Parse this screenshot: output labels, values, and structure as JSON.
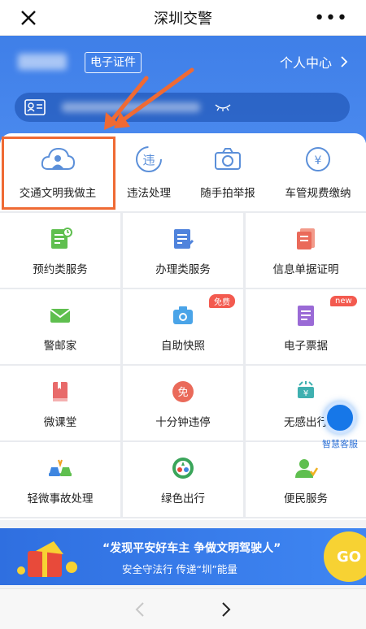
{
  "header": {
    "title": "深圳交警"
  },
  "hero": {
    "cert_tag": "电子证件",
    "personal_center": "个人中心"
  },
  "quick_actions": [
    {
      "label": "交通文明我做主"
    },
    {
      "label": "违法处理"
    },
    {
      "label": "随手拍举报"
    },
    {
      "label": "车管规费缴纳"
    }
  ],
  "grid": [
    {
      "label": "预约类服务"
    },
    {
      "label": "办理类服务"
    },
    {
      "label": "信息单据证明"
    },
    {
      "label": "警邮家"
    },
    {
      "label": "自助快照",
      "badge": "免费"
    },
    {
      "label": "电子票据",
      "badge": "new"
    },
    {
      "label": "微课堂"
    },
    {
      "label": "十分钟违停",
      "icon_text": "免"
    },
    {
      "label": "无感出行",
      "icon_text": "¥"
    },
    {
      "label": "轻微事故处理"
    },
    {
      "label": "绿色出行"
    },
    {
      "label": "便民服务"
    }
  ],
  "smart_service": {
    "label": "智慧客服"
  },
  "banner": {
    "slogan": "“发现平安好车主 争做文明驾驶人”",
    "sub": "安全守法行 传递“圳”能量",
    "go": "GO"
  },
  "colors": {
    "primary": "#3f7fe8",
    "highlight": "#ef6a34",
    "badge": "#f35a4f"
  }
}
